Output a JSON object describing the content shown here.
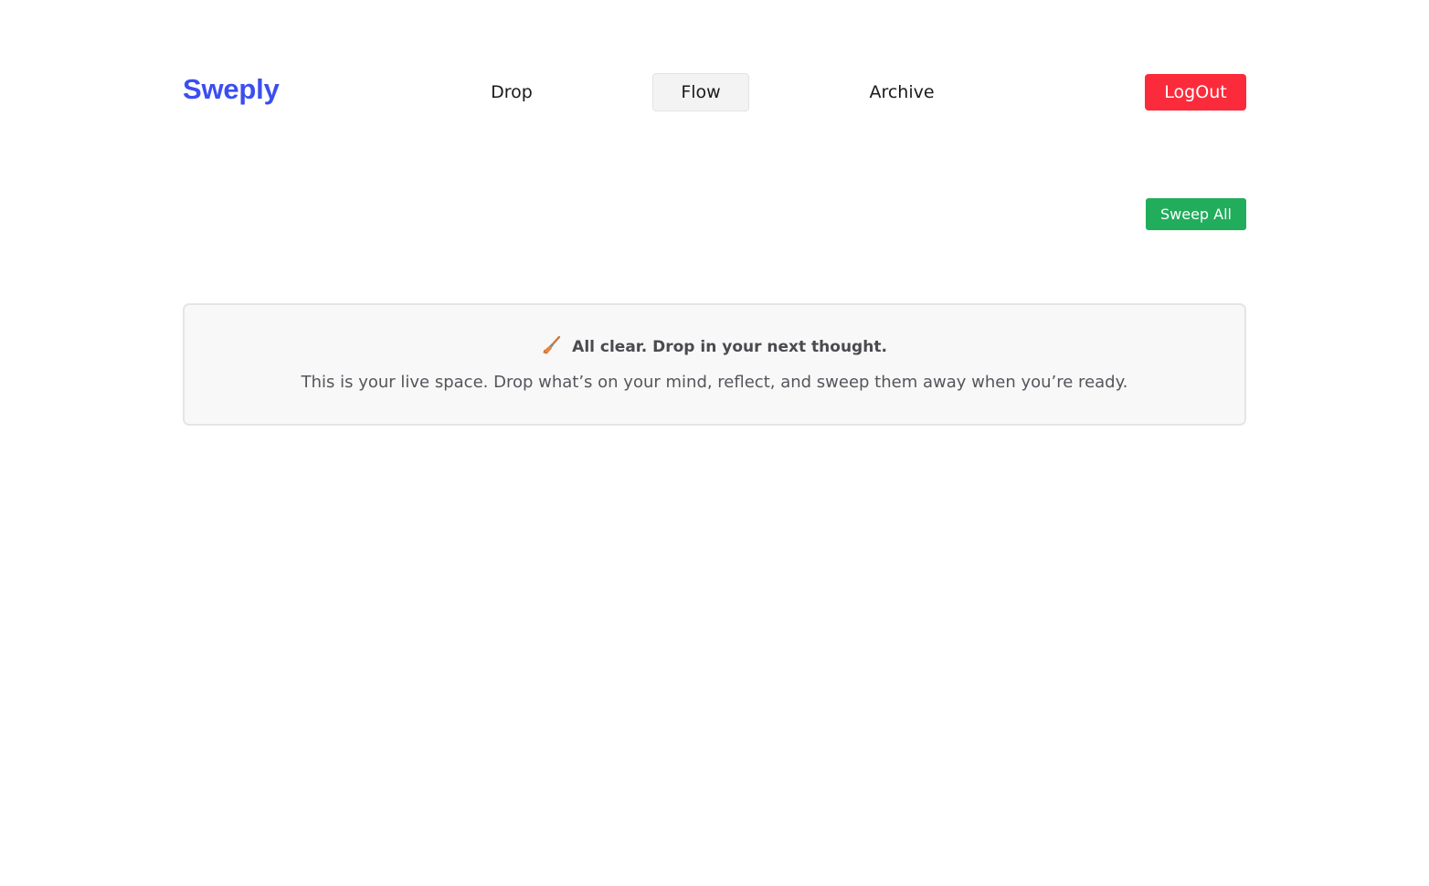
{
  "brand": {
    "name": "Sweply",
    "color": "#3b4ef0"
  },
  "nav": {
    "items": [
      {
        "label": "Drop",
        "active": false
      },
      {
        "label": "Flow",
        "active": true
      },
      {
        "label": "Archive",
        "active": false
      }
    ]
  },
  "header": {
    "logout_label": "LogOut",
    "logout_color": "#fb2b3b"
  },
  "toolbar": {
    "sweep_all_label": "Sweep All",
    "sweep_all_color": "#22ad5c"
  },
  "empty_state": {
    "icon": "broom-icon",
    "title": "All clear. Drop in your next thought.",
    "subtitle": "This is your live space. Drop what’s on your mind, reflect, and sweep them away when you’re ready."
  }
}
